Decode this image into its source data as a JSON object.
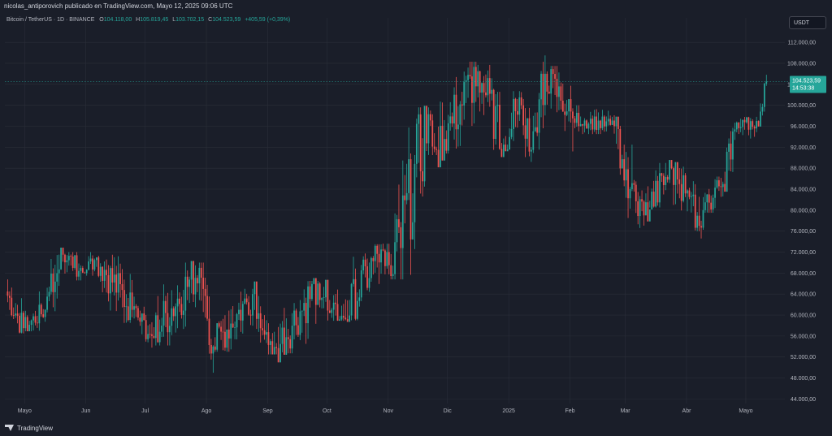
{
  "header": {
    "credit": "nicolas_antiporovich publicado en TradingView.com, Mayo 12, 2025 09:06 UTC"
  },
  "legend": {
    "symbol": "Bitcoin / TetherUS · 1D · BINANCE",
    "o_label": "O",
    "o_value": "104.118,00",
    "h_label": "H",
    "h_value": "105.819,45",
    "l_label": "L",
    "l_value": "103.702,15",
    "c_label": "C",
    "c_value": "104.523,59",
    "change": "+405,59 (+0,39%)"
  },
  "currency_button": "USDT",
  "price_tag": {
    "price": "104.523,59",
    "countdown": "14:53:38"
  },
  "brand": {
    "name": "TradingView"
  },
  "colors": {
    "up": "#26a69a",
    "down": "#ef5350",
    "background": "#1a1e29",
    "grid": "#2a2e39",
    "axis_text": "#b2b5be",
    "tag": "#26a69a"
  },
  "chart_data": {
    "type": "candlestick",
    "y_ticks": [
      "112.000,00",
      "108.000,00",
      "104.000,00",
      "100.000,00",
      "96.000,00",
      "92.000,00",
      "88.000,00",
      "84.000,00",
      "80.000,00",
      "76.000,00",
      "72.000,00",
      "68.000,00",
      "64.000,00",
      "60.000,00",
      "56.000,00",
      "52.000,00",
      "48.000,00",
      "44.000,00"
    ],
    "y_tick_values": [
      112000,
      108000,
      104000,
      100000,
      96000,
      92000,
      88000,
      84000,
      80000,
      76000,
      72000,
      68000,
      64000,
      60000,
      56000,
      52000,
      48000,
      44000
    ],
    "ylim": [
      42200,
      114500
    ],
    "x_ticks": [
      {
        "label": "Mayo",
        "date": "2024-05-01"
      },
      {
        "label": "Jun",
        "date": "2024-06-01"
      },
      {
        "label": "Jul",
        "date": "2024-07-01"
      },
      {
        "label": "Ago",
        "date": "2024-08-01"
      },
      {
        "label": "Sep",
        "date": "2024-09-01"
      },
      {
        "label": "Oct",
        "date": "2024-10-01"
      },
      {
        "label": "Nov",
        "date": "2024-11-01"
      },
      {
        "label": "Dic",
        "date": "2024-12-01"
      },
      {
        "label": "2025",
        "date": "2025-01-01"
      },
      {
        "label": "Feb",
        "date": "2025-02-01"
      },
      {
        "label": "Mar",
        "date": "2025-03-01"
      },
      {
        "label": "Abr",
        "date": "2025-04-01"
      },
      {
        "label": "Mayo",
        "date": "2025-05-01"
      }
    ],
    "xlim": [
      "2024-04-21",
      "2025-05-15"
    ],
    "last_price": 104523.59,
    "series": [
      {
        "start": "2024-04-22",
        "end": "2024-05-01",
        "open": 64500,
        "close": 57500,
        "high": 66800,
        "low": 56500
      },
      {
        "start": "2024-05-01",
        "end": "2024-05-12",
        "open": 57500,
        "close": 61000,
        "high": 64500,
        "low": 56900
      },
      {
        "start": "2024-05-12",
        "end": "2024-05-21",
        "open": 61000,
        "close": 71500,
        "high": 72000,
        "low": 60500
      },
      {
        "start": "2024-05-21",
        "end": "2024-06-01",
        "open": 71500,
        "close": 68000,
        "high": 72000,
        "low": 66600
      },
      {
        "start": "2024-06-01",
        "end": "2024-06-07",
        "open": 68000,
        "close": 71000,
        "high": 72000,
        "low": 67500
      },
      {
        "start": "2024-06-07",
        "end": "2024-06-25",
        "open": 71000,
        "close": 61000,
        "high": 71500,
        "low": 58500
      },
      {
        "start": "2024-06-25",
        "end": "2024-07-05",
        "open": 61000,
        "close": 56000,
        "high": 63500,
        "low": 53800
      },
      {
        "start": "2024-07-05",
        "end": "2024-07-29",
        "open": 56000,
        "close": 69000,
        "high": 70000,
        "low": 54200
      },
      {
        "start": "2024-07-29",
        "end": "2024-08-05",
        "open": 69000,
        "close": 54000,
        "high": 70000,
        "low": 49000
      },
      {
        "start": "2024-08-05",
        "end": "2024-08-25",
        "open": 54000,
        "close": 64000,
        "high": 65000,
        "low": 53000
      },
      {
        "start": "2024-08-25",
        "end": "2024-09-06",
        "open": 64000,
        "close": 53700,
        "high": 65100,
        "low": 52500
      },
      {
        "start": "2024-09-06",
        "end": "2024-09-27",
        "open": 53700,
        "close": 66000,
        "high": 66500,
        "low": 52700
      },
      {
        "start": "2024-09-27",
        "end": "2024-10-10",
        "open": 66000,
        "close": 59500,
        "high": 66500,
        "low": 58900
      },
      {
        "start": "2024-10-10",
        "end": "2024-10-29",
        "open": 59500,
        "close": 72500,
        "high": 73500,
        "low": 59000
      },
      {
        "start": "2024-10-29",
        "end": "2024-11-04",
        "open": 72500,
        "close": 67800,
        "high": 73600,
        "low": 66800
      },
      {
        "start": "2024-11-04",
        "end": "2024-11-22",
        "open": 67800,
        "close": 98300,
        "high": 99600,
        "low": 66800
      },
      {
        "start": "2024-11-22",
        "end": "2024-11-26",
        "open": 98300,
        "close": 91500,
        "high": 99000,
        "low": 90500
      },
      {
        "start": "2024-11-26",
        "end": "2024-12-17",
        "open": 91500,
        "close": 106500,
        "high": 108300,
        "low": 90800
      },
      {
        "start": "2024-12-17",
        "end": "2024-12-30",
        "open": 106500,
        "close": 92500,
        "high": 107700,
        "low": 91500
      },
      {
        "start": "2024-12-30",
        "end": "2025-01-07",
        "open": 92500,
        "close": 101500,
        "high": 102700,
        "low": 91500
      },
      {
        "start": "2025-01-07",
        "end": "2025-01-13",
        "open": 101500,
        "close": 91500,
        "high": 102500,
        "low": 89200
      },
      {
        "start": "2025-01-13",
        "end": "2025-01-20",
        "open": 91500,
        "close": 106000,
        "high": 109500,
        "low": 90900
      },
      {
        "start": "2025-01-20",
        "end": "2025-02-03",
        "open": 106000,
        "close": 97500,
        "high": 107500,
        "low": 91200
      },
      {
        "start": "2025-02-03",
        "end": "2025-02-24",
        "open": 97500,
        "close": 96000,
        "high": 100000,
        "low": 94500
      },
      {
        "start": "2025-02-24",
        "end": "2025-03-04",
        "open": 96000,
        "close": 84000,
        "high": 96500,
        "low": 78500
      },
      {
        "start": "2025-03-04",
        "end": "2025-03-11",
        "open": 84000,
        "close": 79000,
        "high": 92500,
        "low": 76600
      },
      {
        "start": "2025-03-11",
        "end": "2025-03-25",
        "open": 79000,
        "close": 88000,
        "high": 89000,
        "low": 80500
      },
      {
        "start": "2025-03-25",
        "end": "2025-04-08",
        "open": 88000,
        "close": 77000,
        "high": 88300,
        "low": 76000
      },
      {
        "start": "2025-04-08",
        "end": "2025-04-10",
        "open": 77000,
        "close": 80000,
        "high": 82500,
        "low": 74600
      },
      {
        "start": "2025-04-10",
        "end": "2025-04-20",
        "open": 80000,
        "close": 85000,
        "high": 86400,
        "low": 79500
      },
      {
        "start": "2025-04-20",
        "end": "2025-04-25",
        "open": 85000,
        "close": 95000,
        "high": 95700,
        "low": 84500
      },
      {
        "start": "2025-04-25",
        "end": "2025-05-07",
        "open": 95000,
        "close": 97000,
        "high": 97800,
        "low": 93400
      },
      {
        "start": "2025-05-07",
        "end": "2025-05-11",
        "open": 97000,
        "close": 104118,
        "high": 104300,
        "low": 96500
      },
      {
        "start": "2025-05-11",
        "end": "2025-05-12",
        "open": 104118,
        "close": 104523.59,
        "high": 105819.45,
        "low": 103702.15
      }
    ]
  }
}
